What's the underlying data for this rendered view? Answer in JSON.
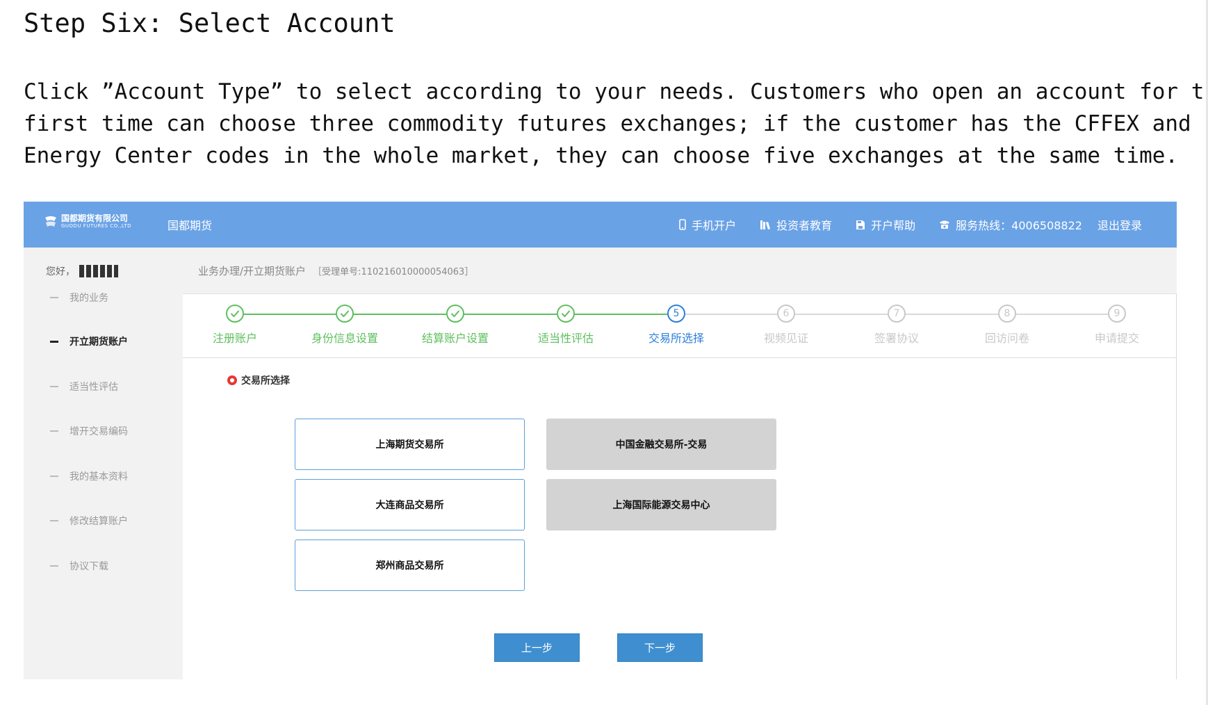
{
  "doc": {
    "title": "Step Six: Select Account",
    "lines": [
      "Click ”Account Type” to select according to your needs. Customers who open an account for the",
      "first time can choose three commodity futures exchanges; if the customer has the CFFEX and",
      "Energy Center codes in the whole market, they can choose five exchanges at the same time."
    ]
  },
  "app": {
    "logo": {
      "cn": "国都期货有限公司",
      "en": "GUODU FUTURES CO.,LTD"
    },
    "brand": "国都期货",
    "nav": [
      {
        "label": "手机开户",
        "icon": "mobile-icon"
      },
      {
        "label": "投资者教育",
        "icon": "books-icon"
      },
      {
        "label": "开户帮助",
        "icon": "save-icon"
      },
      {
        "label": "服务热线：4006508822",
        "icon": "phone-icon"
      },
      {
        "label": "退出登录",
        "icon": ""
      }
    ],
    "accent": "#6aa2e6"
  },
  "sidebar": {
    "greeting": "您好，",
    "items": [
      {
        "label": "我的业务",
        "active": false
      },
      {
        "label": "开立期货账户",
        "active": true
      },
      {
        "label": "适当性评估",
        "active": false
      },
      {
        "label": "增开交易编码",
        "active": false
      },
      {
        "label": "我的基本资料",
        "active": false
      },
      {
        "label": "修改结算账户",
        "active": false
      },
      {
        "label": "协议下载",
        "active": false
      }
    ]
  },
  "breadcrumb": {
    "path": "业务办理/开立期货账户",
    "ticket": "［受理单号:110216010000054063］"
  },
  "steps": [
    {
      "num": "1",
      "label": "注册账户",
      "state": "done"
    },
    {
      "num": "2",
      "label": "身份信息设置",
      "state": "done"
    },
    {
      "num": "3",
      "label": "结算账户设置",
      "state": "done"
    },
    {
      "num": "4",
      "label": "适当性评估",
      "state": "done"
    },
    {
      "num": "5",
      "label": "交易所选择",
      "state": "current"
    },
    {
      "num": "6",
      "label": "视频见证",
      "state": "todo"
    },
    {
      "num": "7",
      "label": "签署协议",
      "state": "todo"
    },
    {
      "num": "8",
      "label": "回访问卷",
      "state": "todo"
    },
    {
      "num": "9",
      "label": "申请提交",
      "state": "todo"
    }
  ],
  "section": {
    "title": "交易所选择"
  },
  "exchanges": {
    "shfe": "上海期货交易所",
    "dce": "大连商品交易所",
    "czce": "郑州商品交易所",
    "cffex": "中国金融交易所-交易",
    "ine": "上海国际能源交易中心"
  },
  "buttons": {
    "prev": "上一步",
    "next": "下一步"
  },
  "colors": {
    "done": "#5fbf5f",
    "current": "#2e7fd8",
    "todo": "#c8c8c8",
    "button": "#3f8fd0"
  }
}
